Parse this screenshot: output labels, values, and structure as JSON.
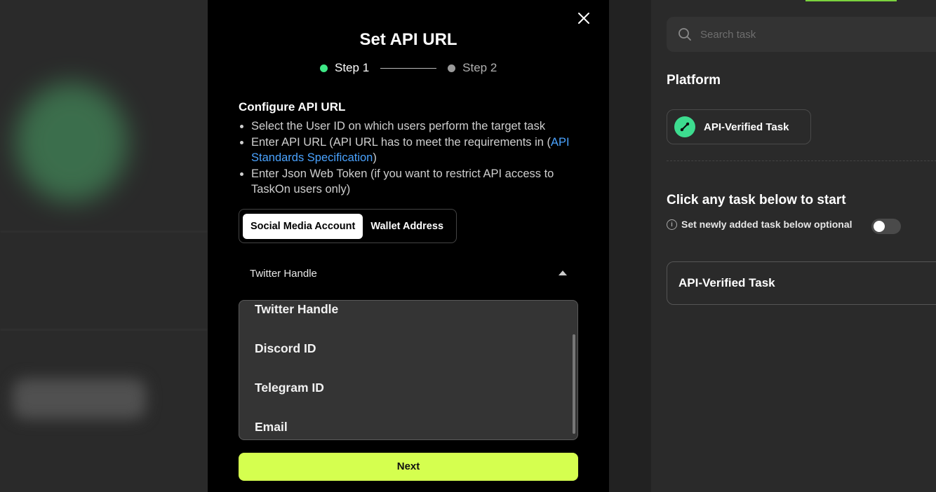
{
  "modal": {
    "title": "Set API URL",
    "close_icon": "close-icon",
    "steps": [
      {
        "label": "Step 1",
        "state": "active",
        "color": "#3ee886"
      },
      {
        "label": "Step 2",
        "state": "inactive",
        "color": "#9a9a9a"
      }
    ],
    "config_title": "Configure API URL",
    "bullets": {
      "b1": "Select the User ID on which users perform the target task",
      "b2_pre": "Enter API URL (API URL has to meet the requirements in (",
      "b2_link": "API Standards Specification",
      "b2_post": ")",
      "b3": "Enter Json Web Token (if you want to restrict API access to TaskOn users only)"
    },
    "segmented": {
      "options": [
        "Social Media Account",
        "Wallet Address"
      ],
      "selected": "Social Media Account"
    },
    "select": {
      "value": "Twitter Handle",
      "caret_icon": "caret-up-icon"
    },
    "dropdown_options": [
      "Twitter Handle",
      "Discord ID",
      "Telegram ID",
      "Email"
    ],
    "next_label": "Next",
    "accent": "#d5ff4f"
  },
  "right_panel": {
    "search_placeholder": "Search task",
    "search_icon": "search-icon",
    "platform_title": "Platform",
    "platform_card_label": "API-Verified Task",
    "start_title": "Click any task below to start",
    "optional_label": "Set newly added task below optional",
    "optional_toggle_on": false,
    "task_card_label": "API-Verified Task"
  }
}
